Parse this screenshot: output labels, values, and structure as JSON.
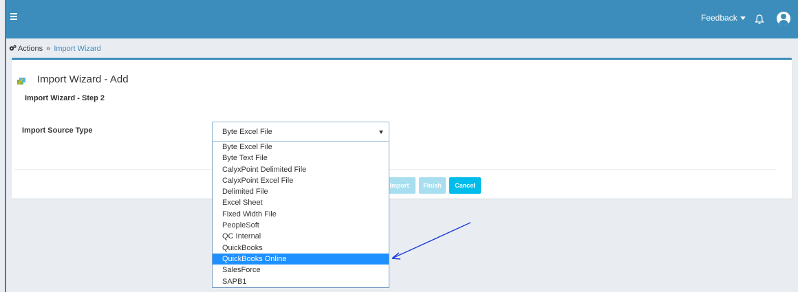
{
  "topbar": {
    "menu_icon": "hamburger-icon",
    "feedback_label": "Feedback",
    "bell_icon": "bell-icon",
    "avatar_icon": "user-avatar-icon",
    "color": "#3c8dbc"
  },
  "breadcrumb": {
    "icon": "gears-icon",
    "root": "Actions",
    "separator": "»",
    "current": "Import Wizard"
  },
  "panel": {
    "title": "Import Wizard - Add",
    "step": "Import Wizard - Step 2",
    "field_label": "Import Source Type"
  },
  "select": {
    "value": "Byte Excel File",
    "options": [
      "Byte Excel File",
      "Byte Text File",
      "CalyxPoint Delimited File",
      "CalyxPoint Excel File",
      "Delimited File",
      "Excel Sheet",
      "Fixed Width File",
      "PeopleSoft",
      "QC Internal",
      "QuickBooks",
      "QuickBooks Online",
      "SalesForce",
      "SAPB1"
    ],
    "highlighted": "QuickBooks Online"
  },
  "buttons": {
    "import": "Import",
    "finish": "Finish",
    "cancel": "Cancel"
  },
  "colors": {
    "accent": "#3c8dbc",
    "button_active": "#00bcea",
    "button_disabled": "#a8dff0",
    "highlight": "#1e90ff",
    "annotation_arrow": "#1f3fd8"
  }
}
